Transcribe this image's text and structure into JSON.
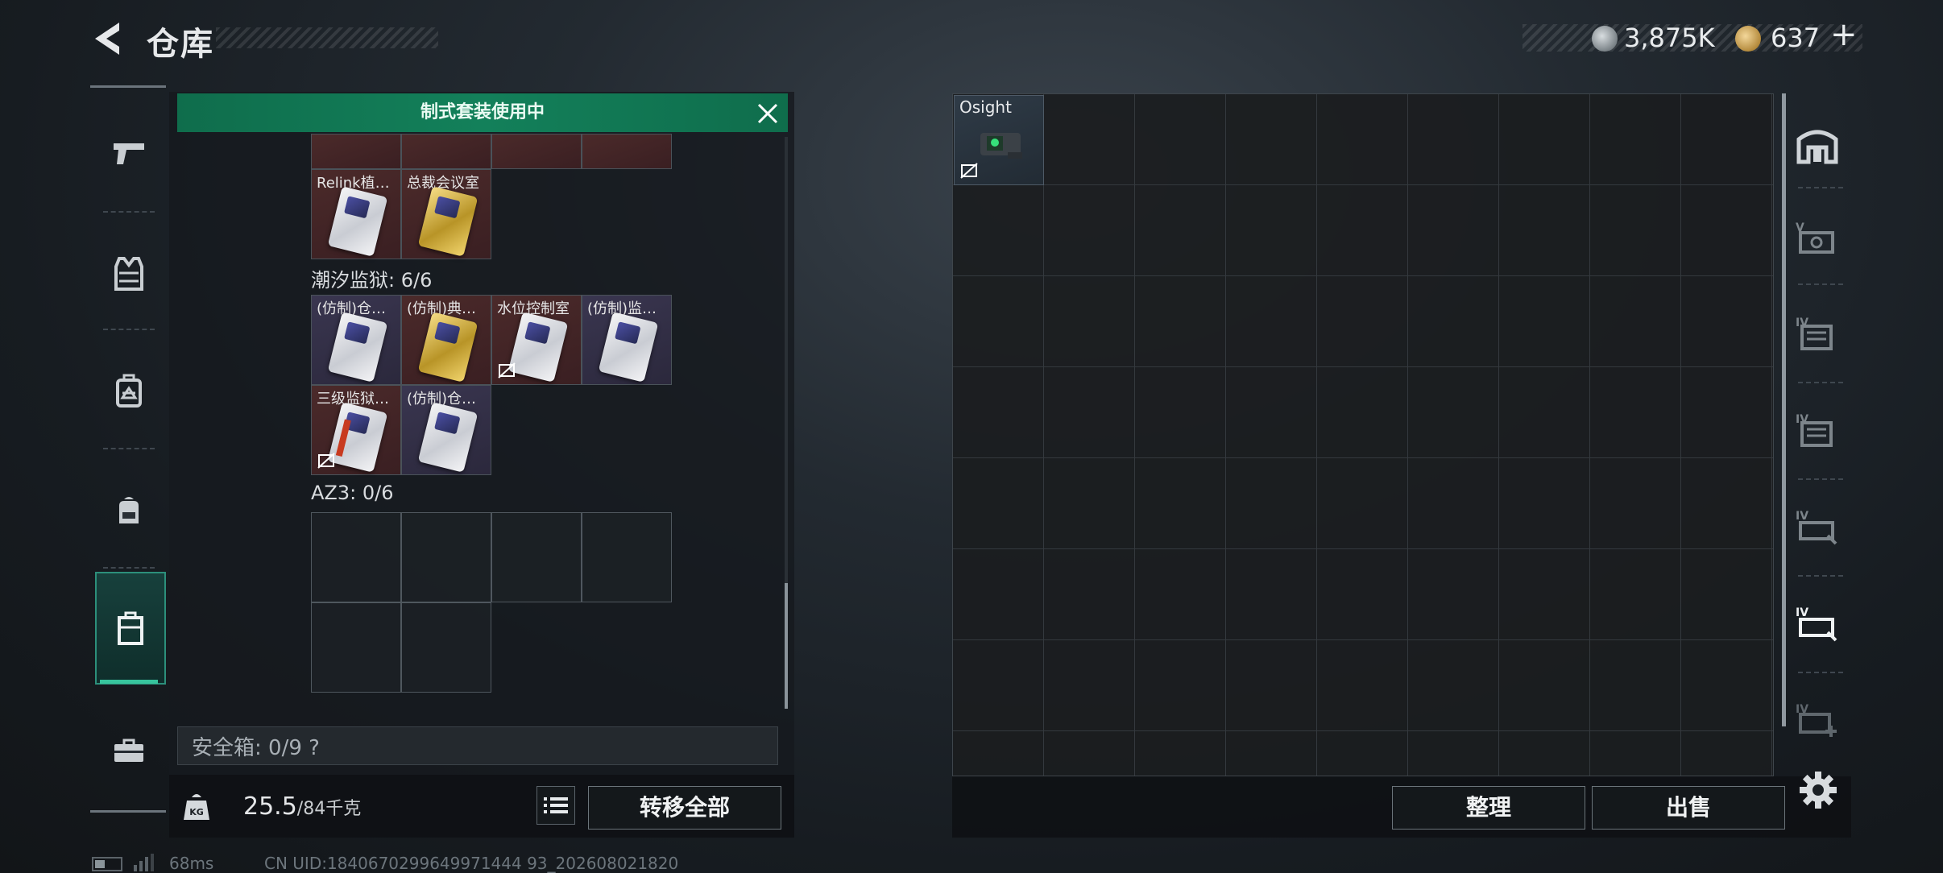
{
  "header": {
    "title": "仓库"
  },
  "currency": {
    "silver": "3,875K",
    "gold": "637",
    "add_label": "+"
  },
  "banner": {
    "text": "制式套装使用中"
  },
  "containers": {
    "partial_items": [
      {},
      {},
      {},
      {}
    ],
    "group1_extra": [
      {
        "name": "Relink植…",
        "card": "white"
      },
      {
        "name": "总裁会议室",
        "card": "gold"
      }
    ],
    "group2": {
      "label": "潮汐监狱: 6/6",
      "items": [
        {
          "name": "(仿制)仓…",
          "card": "white"
        },
        {
          "name": "(仿制)典…",
          "card": "gold"
        },
        {
          "name": "水位控制室",
          "card": "white"
        },
        {
          "name": "(仿制)监…",
          "card": "white"
        },
        {
          "name": "三级监狱…",
          "card": "red"
        },
        {
          "name": "(仿制)仓…",
          "card": "white"
        }
      ]
    },
    "group3": {
      "label": "AZ3: 0/6"
    }
  },
  "safebox": {
    "text": "安全箱: 0/9 ?"
  },
  "weight": {
    "current": "25.5",
    "max": "/84千克"
  },
  "buttons": {
    "transfer_all": "转移全部",
    "sort": "整理",
    "sell": "出售"
  },
  "stash": {
    "item_name": "Osight"
  },
  "status": {
    "ping": "68ms",
    "uid": "CN UID:1840670299649971444 93_202608021820"
  },
  "colors": {
    "accent_green": "#13805a",
    "active_tab": "#37c49d"
  },
  "icons": {
    "left_categories": [
      "pistol-icon",
      "vest-icon",
      "chest-rig-icon",
      "backpack-icon",
      "secure-container-icon",
      "medkit-icon"
    ],
    "right_tabs": [
      "home-icon",
      "stash-tab-icon-1",
      "stash-tab-icon-2",
      "stash-tab-icon-3",
      "stash-tab-icon-4",
      "stash-tab-icon-5",
      "stash-tab-add-icon"
    ]
  }
}
